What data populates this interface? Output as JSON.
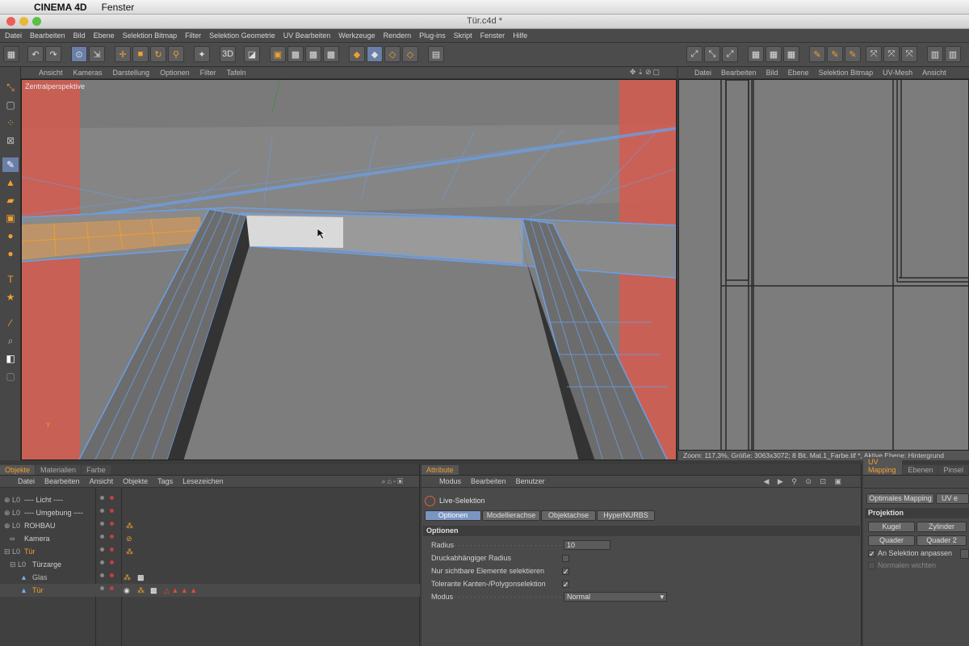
{
  "mac": {
    "app": "CINEMA 4D",
    "menu": "Fenster"
  },
  "window": {
    "title": "Tür.c4d *"
  },
  "menubar": [
    "Datei",
    "Bearbeiten",
    "Bild",
    "Ebene",
    "Selektion Bitmap",
    "Filter",
    "Selektion Geometrie",
    "UV Bearbeiten",
    "Werkzeuge",
    "Rendern",
    "Plug-ins",
    "Skript",
    "Fenster",
    "Hilfe"
  ],
  "viewport": {
    "menu": [
      "Ansicht",
      "Kameras",
      "Darstellung",
      "Optionen",
      "Filter",
      "Tafeln"
    ],
    "label": "Zentralperspektive",
    "axis_label": "Y"
  },
  "uv": {
    "menu": [
      "Datei",
      "Bearbeiten",
      "Bild",
      "Ebene",
      "Selektion Bitmap",
      "UV-Mesh",
      "Ansicht"
    ],
    "status": "Zoom: 117,3%, Größe: 3063x3072; 8 Bit. Mat.1_Farbe.tif *, Aktive Ebene: Hintergrund"
  },
  "objects": {
    "tabs": [
      "Objekte",
      "Materialien",
      "Farbe"
    ],
    "menu": [
      "Datei",
      "Bearbeiten",
      "Ansicht",
      "Objekte",
      "Tags",
      "Lesezeichen"
    ],
    "rows": [
      {
        "name": "---- Licht ----",
        "icon": "L0"
      },
      {
        "name": "---- Umgebung ----",
        "icon": "L0"
      },
      {
        "name": "ROHBAU",
        "icon": "L0"
      },
      {
        "name": "Kamera",
        "icon": "oo"
      },
      {
        "name": "Tür",
        "icon": "L0"
      },
      {
        "name": "Türzarge",
        "icon": "L0"
      },
      {
        "name": "Glas",
        "icon": "Δ"
      },
      {
        "name": "Tür",
        "icon": "Δ"
      }
    ]
  },
  "attributes": {
    "tab": "Attribute",
    "menu": [
      "Modus",
      "Bearbeiten",
      "Benutzer"
    ],
    "tool": "Live-Selektion",
    "subtabs": [
      "Optionen",
      "Modellierachse",
      "Objektachse",
      "HyperNURBS"
    ],
    "section": "Optionen",
    "fields": {
      "radius_label": "Radius",
      "radius_value": "10",
      "pressure_label": "Druckabhängiger Radius",
      "visible_label": "Nur sichtbare Elemente selektieren",
      "tolerant_label": "Tolerante Kanten-/Polygonselektion",
      "mode_label": "Modus",
      "mode_value": "Normal"
    }
  },
  "uvtools": {
    "tabs": [
      "UV Mapping",
      "Ebenen",
      "Pinsel"
    ],
    "buttons_top": [
      "Optimales Mapping",
      "UV e"
    ],
    "section": "Projektion",
    "proj_buttons": [
      "Kugel",
      "Zylinder",
      "Quader",
      "Quader 2"
    ],
    "check1": "An Selektion anpassen",
    "check2": "Normalen wichten"
  },
  "colors": {
    "accent": "#f0a030",
    "wire": "#6a9fe8",
    "selection": "#d96055"
  }
}
